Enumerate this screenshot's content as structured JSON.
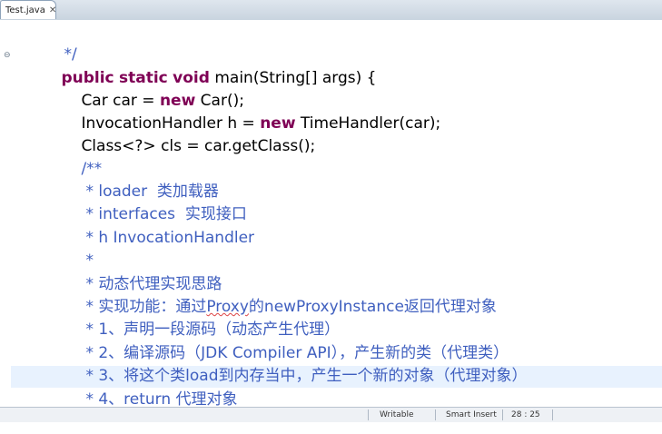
{
  "tab": {
    "label": "Test.java",
    "close": "✕"
  },
  "code": {
    "l1": "*/",
    "l2": {
      "kw1": "public",
      "kw2": "static",
      "kw3": "void",
      "rest": " main(String[] args) {"
    },
    "l3": {
      "pre": "Car car = ",
      "kw": "new",
      "post": " Car();"
    },
    "l4": {
      "pre": "InvocationHandler h = ",
      "kw": "new",
      "post": " TimeHandler(car);"
    },
    "l5": "Class<?> cls = car.getClass();",
    "l6": "/**",
    "l7": "* loader  类加载器",
    "l8": "* interfaces  实现接口",
    "l9": "* h InvocationHandler",
    "l10": "*",
    "l11": "* 动态代理实现思路",
    "l12": {
      "pre": "* 实现功能：通过",
      "warn": "Proxy",
      "post": "的newProxyInstance返回代理对象"
    },
    "l13": "* 1、声明一段源码（动态产生代理）",
    "l14": "* 2、编译源码（JDK Compiler API），产生新的类（代理类）",
    "l15": "* 3、将这个类load到内存当中，产生一个新的对象（代理对象）",
    "l16": "* 4、return 代理对象",
    "l17": "*"
  },
  "status": {
    "mode": "Writable",
    "insert": "Smart Insert",
    "position": "28 : 25"
  },
  "colors": {
    "keyword": "#7f0055",
    "comment": "#3f5fbf",
    "highlight": "#e8f2fe"
  }
}
